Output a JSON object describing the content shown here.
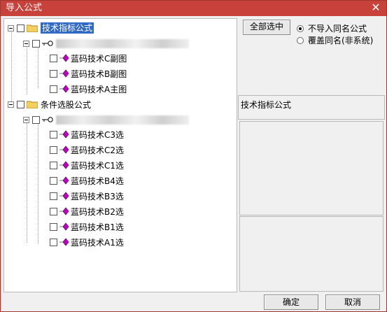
{
  "window": {
    "title": "导入公式",
    "close_glyph": "✕"
  },
  "tree": {
    "groups": [
      {
        "label": "技术指标公式",
        "selected": true,
        "items": [
          "蓝码技术C副图",
          "蓝码技术B副图",
          "蓝码技术A主图"
        ]
      },
      {
        "label": "条件选股公式",
        "selected": false,
        "items": [
          "蓝码技术C3选",
          "蓝码技术C2选",
          "蓝码技术C1选",
          "蓝码技术B4选",
          "蓝码技术B3选",
          "蓝码技术B2选",
          "蓝码技术B1选",
          "蓝码技术A1选"
        ]
      }
    ]
  },
  "options": {
    "select_all": "全部选中",
    "radio_skip": "不导入同名公式",
    "radio_overwrite": "覆盖同名(非系统)",
    "radio_selected": "skip"
  },
  "info": {
    "category_label": "技术指标公式"
  },
  "footer": {
    "ok": "确定",
    "cancel": "取消"
  },
  "colors": {
    "titlebar": "#c8413a",
    "selection": "#316ac5",
    "item_icon": "#c000c0",
    "folder": "#f2cf5e"
  }
}
